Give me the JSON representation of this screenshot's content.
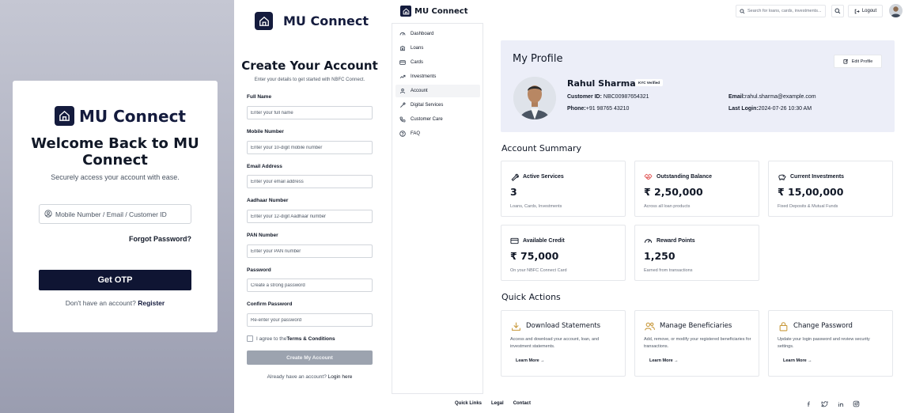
{
  "login": {
    "brand": "MU Connect",
    "title": "Welcome Back to MU Connect",
    "subtitle": "Securely access your account with ease.",
    "input_placeholder": "Mobile Number / Email / Customer ID",
    "forgot": "Forgot Password?",
    "otp_button": "Get OTP",
    "no_account": "Don't have an account?",
    "register": "Register"
  },
  "register": {
    "brand": "MU Connect",
    "title": "Create Your Account",
    "subtitle": "Enter your details to get started with NBFC Connect.",
    "fields": [
      {
        "label": "Full Name",
        "placeholder": "Enter your full name"
      },
      {
        "label": "Mobile Number",
        "placeholder": "Enter your 10-digit mobile number"
      },
      {
        "label": "Email Address",
        "placeholder": "Enter your email address"
      },
      {
        "label": "Aadhaar Number",
        "placeholder": "Enter your 12-digit Aadhaar number"
      },
      {
        "label": "PAN Number",
        "placeholder": "Enter your PAN number"
      },
      {
        "label": "Password",
        "placeholder": "Create a strong password"
      },
      {
        "label": "Confirm Password",
        "placeholder": "Re-enter your password"
      }
    ],
    "agree_prefix": "I agree to the",
    "agree_terms": "Terms & Conditions",
    "create_button": "Create My Account",
    "have_account": "Already have an account?",
    "login_here": "Login here"
  },
  "dashboard": {
    "brand": "MU Connect",
    "search_placeholder": "Search for loans, cards, investments...",
    "logout": "Logout",
    "sidebar": [
      {
        "label": "Dashboard",
        "icon": "dashboard-icon"
      },
      {
        "label": "Loans",
        "icon": "loans-icon"
      },
      {
        "label": "Cards",
        "icon": "card-icon"
      },
      {
        "label": "Investments",
        "icon": "investments-icon"
      },
      {
        "label": "Account",
        "icon": "account-icon",
        "active": true
      },
      {
        "label": "Digital Services",
        "icon": "digital-services-icon"
      },
      {
        "label": "Customer Care",
        "icon": "phone-icon"
      },
      {
        "label": "FAQ",
        "icon": "faq-icon"
      }
    ],
    "profile": {
      "title": "My Profile",
      "edit": "Edit Profile",
      "name": "Rahul Sharma",
      "kyc": "KYC Verified",
      "customer_id_label": "Customer ID:",
      "customer_id": "NBC00987654321",
      "phone_label": "Phone:",
      "phone": "+91 98765 43210",
      "email_label": "Email:",
      "email": "rahul.sharma@example.com",
      "last_login_label": "Last Login:",
      "last_login": "2024-07-26 10:30 AM"
    },
    "summary_title": "Account Summary",
    "summary": [
      {
        "label": "Active Services",
        "value": "3",
        "note": "Loans, Cards, Investments",
        "icon": "wrench-icon"
      },
      {
        "label": "Outstanding Balance",
        "value": "₹ 2,50,000",
        "note": "Across all loan products",
        "icon": "handshake-icon"
      },
      {
        "label": "Current Investments",
        "value": "₹ 15,00,000",
        "note": "Fixed Deposits & Mutual Funds",
        "icon": "piggy-bank-icon"
      },
      {
        "label": "Available Credit",
        "value": "₹ 75,000",
        "note": "On your NBFC Connect Card",
        "icon": "credit-card-icon"
      },
      {
        "label": "Reward Points",
        "value": "1,250",
        "note": "Earned from transactions",
        "icon": "gauge-icon"
      }
    ],
    "quick_title": "Quick Actions",
    "quick": [
      {
        "title": "Download Statements",
        "desc": "Access and download your account, loan, and investment statements.",
        "link": "Learn More →",
        "icon": "download-icon"
      },
      {
        "title": "Manage Beneficiaries",
        "desc": "Add, remove, or modify your registered beneficiaries for transactions.",
        "link": "Learn More →",
        "icon": "users-icon"
      },
      {
        "title": "Change Password",
        "desc": "Update your login password and review security settings.",
        "link": "Learn More →",
        "icon": "lock-icon"
      }
    ],
    "footer": [
      "Quick Links",
      "Legal",
      "Contact"
    ],
    "colors": {
      "brand": "#141b3d",
      "accent": "#c99a3d",
      "profile_bg": "#eceef8"
    }
  }
}
